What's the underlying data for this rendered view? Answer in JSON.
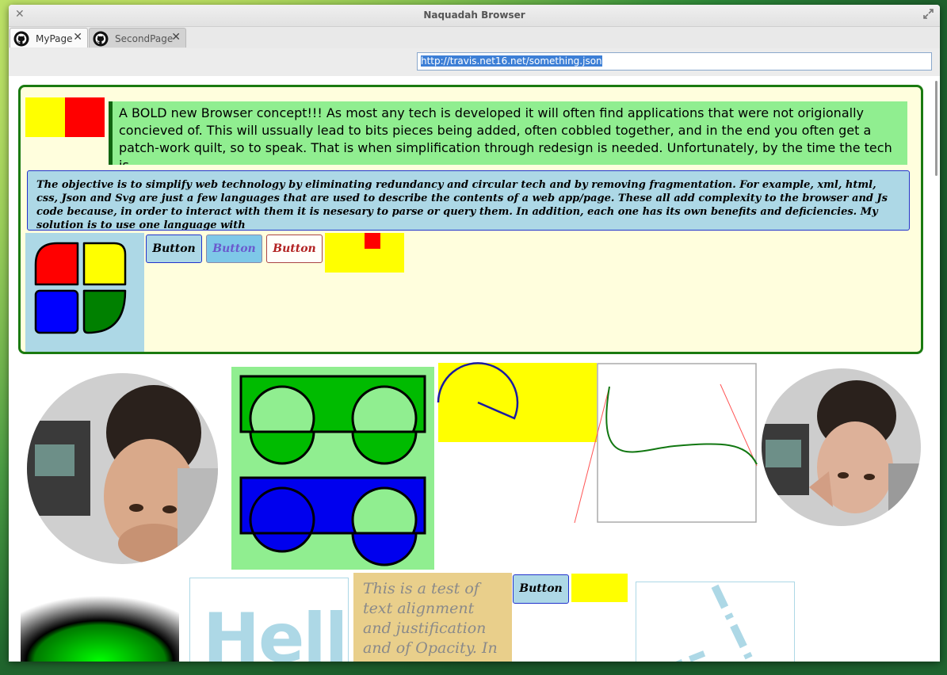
{
  "window": {
    "title": "Naquadah Browser"
  },
  "tabs": [
    {
      "label": "MyPage",
      "icon": "github-icon",
      "close": "✕"
    },
    {
      "label": "SecondPage",
      "icon": "github-icon",
      "close": "✕"
    }
  ],
  "address_bar": {
    "url": "http://travis.net16.net/something.json"
  },
  "page": {
    "bold_paragraph": "A BOLD new Browser concept!!! As most any tech is developed it will often find applications that were not origionally concieved of. This will ussually lead to bits pieces being added, often cobbled together, and in the end you often get a patch-work quilt, so to speak. That is when simplification through redesign is needed. Unfortunately, by the time the tech is",
    "objective_paragraph": "The objective is to simplify web technology by eliminating redundancy and circular tech and by removing fragmentation. For example, xml, html, css, Json and Svg are just a few languages that are used to describe the contents of a web app/page. These all add complexity to the browser and Js code because, in order to interact with them it is nesesary to parse or query them. In addition, each one has its own benefits and deficiencies. My solution is to use one language with",
    "buttons": [
      "Button",
      "Button",
      "Button"
    ],
    "hello_text": "Hello",
    "test_text": "This is a test of text alignment and justification and of Opacity. In",
    "bottom_button": "Button"
  },
  "colors": {
    "frame_green": "#1a7a10",
    "light_blue": "#add8e6",
    "light_green": "#90ee90",
    "yellow": "#ffff00",
    "red": "#ff0000",
    "blue": "#0000ff",
    "green": "#008000",
    "cream": "#fffedd"
  }
}
